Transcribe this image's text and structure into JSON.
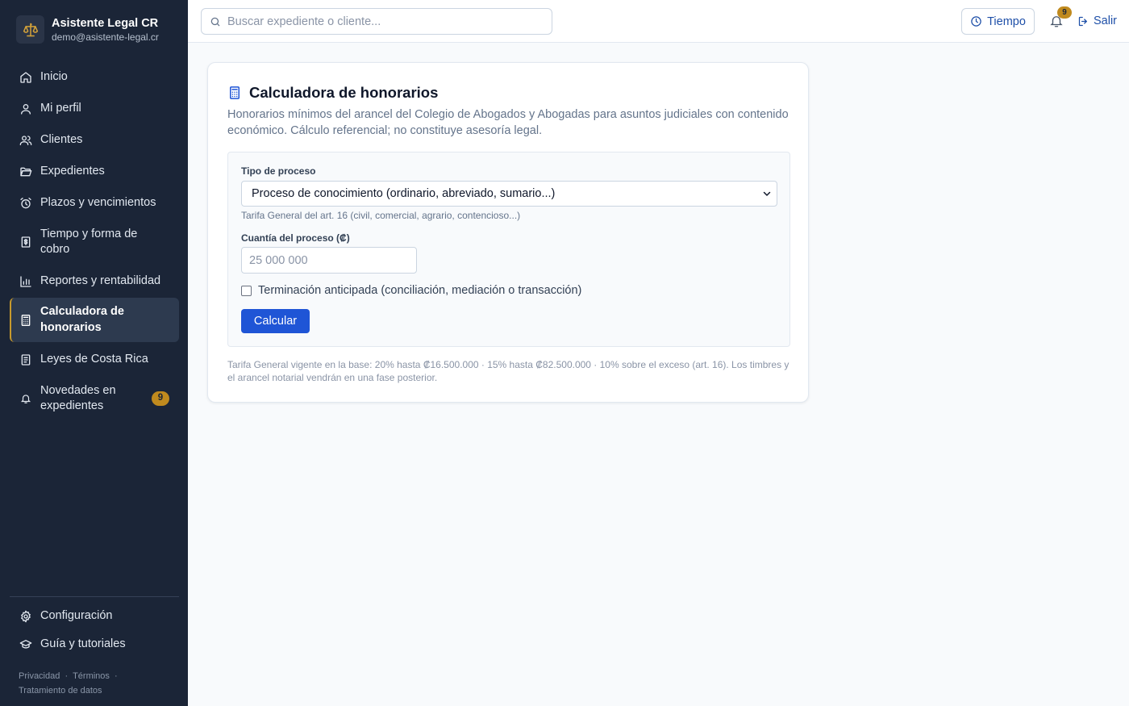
{
  "brand": {
    "title": "Asistente Legal CR",
    "email": "demo@asistente-legal.cr"
  },
  "sidebar": {
    "items": [
      {
        "label": "Inicio",
        "icon": "home-icon"
      },
      {
        "label": "Mi perfil",
        "icon": "user-icon"
      },
      {
        "label": "Clientes",
        "icon": "users-icon"
      },
      {
        "label": "Expedientes",
        "icon": "folder-icon"
      },
      {
        "label": "Plazos y vencimientos",
        "icon": "alarm-icon"
      },
      {
        "label": "Tiempo y forma de cobro",
        "icon": "receipt-icon"
      },
      {
        "label": "Reportes y rentabilidad",
        "icon": "bar-chart-icon"
      },
      {
        "label": "Calculadora de honorarios",
        "icon": "calculator-icon",
        "active": true
      },
      {
        "label": "Leyes de Costa Rica",
        "icon": "book-icon"
      },
      {
        "label": "Novedades en expedientes",
        "icon": "bell-icon",
        "badge": "9"
      }
    ],
    "bottom_items": [
      {
        "label": "Configuración",
        "icon": "gear-icon"
      },
      {
        "label": "Guía y tutoriales",
        "icon": "graduation-cap-icon"
      }
    ],
    "legal": {
      "privacy": "Privacidad",
      "terms": "Términos",
      "data": "Tratamiento de datos",
      "separator": "·"
    }
  },
  "topbar": {
    "search_placeholder": "Buscar expediente o cliente...",
    "tiempo_label": "Tiempo",
    "notifications_count": "9",
    "logout_label": "Salir"
  },
  "card": {
    "title": "Calculadora de honorarios",
    "description": "Honorarios mínimos del arancel del Colegio de Abogados y Abogadas para asuntos judiciales con contenido económico. Cálculo referencial; no constituye asesoría legal.",
    "form": {
      "process_type_label": "Tipo de proceso",
      "process_type_value": "Proceso de conocimiento (ordinario, abreviado, sumario...)",
      "process_type_hint": "Tarifa General del art. 16 (civil, comercial, agrario, contencioso...)",
      "amount_label": "Cuantía del proceso (₡)",
      "amount_value": "",
      "amount_placeholder": "25 000 000",
      "early_termination_label": "Terminación anticipada (conciliación, mediación o transacción)",
      "early_termination_checked": false,
      "submit_label": "Calcular"
    },
    "footnote": "Tarifa General vigente en la base: 20% hasta ₡16.500.000 · 15% hasta ₡82.500.000 · 10% sobre el exceso (art. 16). Los timbres y el arancel notarial vendrán en una fase posterior."
  },
  "colors": {
    "sidebar_bg": "#1b2537",
    "accent_gold": "#c08a1e",
    "primary_blue": "#1f55d6",
    "link_blue": "#1e4fa8"
  }
}
